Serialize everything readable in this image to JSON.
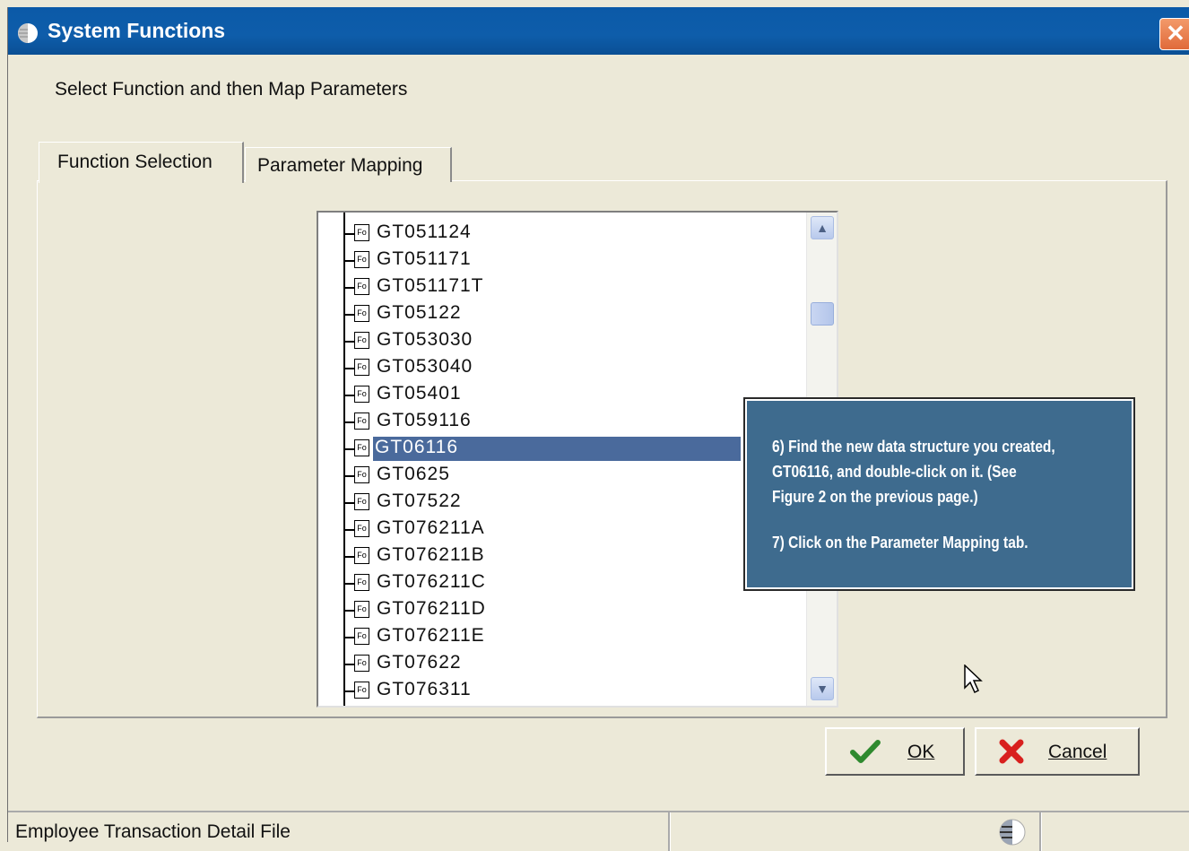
{
  "window": {
    "title": "System Functions",
    "close_glyph": "✕"
  },
  "instruction": "Select Function and then Map Parameters",
  "tabs": [
    {
      "label": "Function Selection",
      "selected": true
    },
    {
      "label": "Parameter Mapping",
      "selected": false
    }
  ],
  "tree": {
    "icon_label": "Fo",
    "selected_item": "GT06116",
    "items": [
      "GT051124",
      "GT051171",
      "GT051171T",
      "GT05122",
      "GT053030",
      "GT053040",
      "GT05401",
      "GT059116",
      "GT06116",
      "GT0625",
      "GT07522",
      "GT076211A",
      "GT076211B",
      "GT076211C",
      "GT076211D",
      "GT076211E",
      "GT07622",
      "GT076311"
    ],
    "scroll_up_glyph": "▲",
    "scroll_down_glyph": "▼"
  },
  "callout": {
    "step6": "6) Find the new data structure you created,\n  GT06116, and double-click on it. (See\n  Figure 2 on the previous page.)",
    "step7": "7) Click on the Parameter Mapping tab."
  },
  "buttons": {
    "ok_label": "OK",
    "cancel_label": "Cancel"
  },
  "statusbar": {
    "text": "Employee Transaction Detail File"
  },
  "colors": {
    "titlebar": "#0b5aa8",
    "selection": "#4a6a9c",
    "callout_bg": "#3e6b8e",
    "ok_check": "#2f8a2f",
    "cancel_x": "#d8201e"
  },
  "icons": {
    "title": "app-globe-icon",
    "ok": "checkmark-icon",
    "cancel": "red-x-icon",
    "status": "network-globe-icon",
    "cursor": "mouse-pointer-icon"
  }
}
